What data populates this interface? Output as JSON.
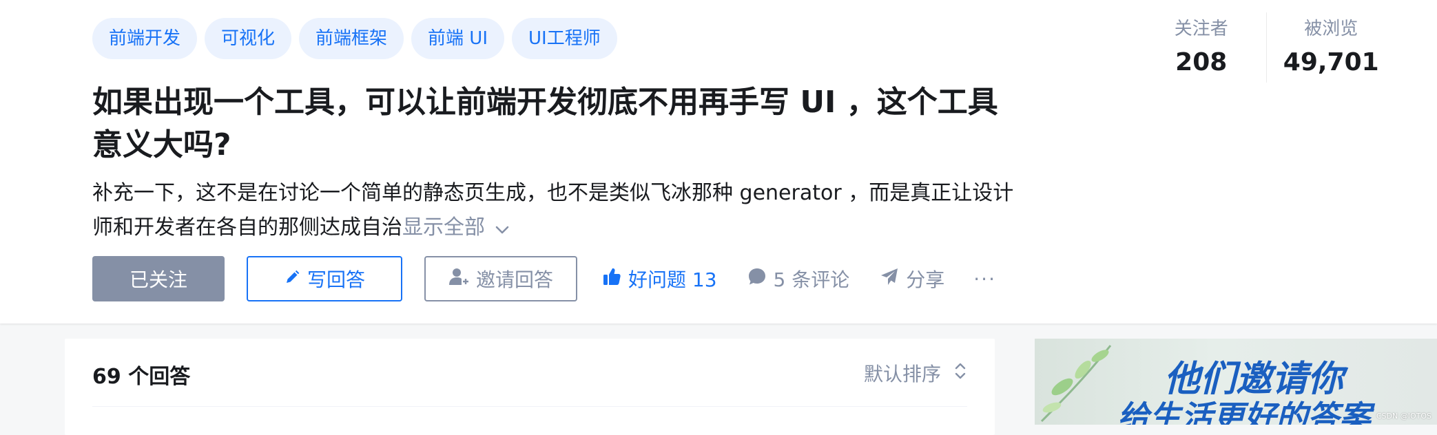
{
  "tags": [
    "前端开发",
    "可视化",
    "前端框架",
    "前端 UI",
    "UI工程师"
  ],
  "question": {
    "title": "如果出现一个工具，可以让前端开发彻底不用再手写 UI ，这个工具意义大吗?",
    "detail": "补充一下，这不是在讨论一个简单的静态页生成，也不是类似飞冰那种 generator ，而是真正让设计师和开发者在各自的那侧达成自治",
    "show_all": "显示全部"
  },
  "actions": {
    "followed": "已关注",
    "write_answer": "写回答",
    "invite_answer": "邀请回答",
    "good_question": "好问题 13",
    "comments": "5 条评论",
    "share": "分享",
    "more": "···"
  },
  "stats": {
    "followers_label": "关注者",
    "followers_value": "208",
    "views_label": "被浏览",
    "views_value": "49,701"
  },
  "answers": {
    "count_label": "69 个回答",
    "sort_label": "默认排序"
  },
  "banner": {
    "line1": "他们邀请你",
    "line2": "给生活更好的答案",
    "watermark": "CSDN @IOTOS"
  },
  "colors": {
    "brand_blue": "#1772f6",
    "muted_gray": "#8590a6",
    "tag_bg": "#ebf2fe"
  },
  "icons": [
    "pencil-icon",
    "invite-user-icon",
    "thumbs-up-icon",
    "comment-bubble-icon",
    "share-plane-icon",
    "chevron-down-icon",
    "sort-updown-icon"
  ]
}
